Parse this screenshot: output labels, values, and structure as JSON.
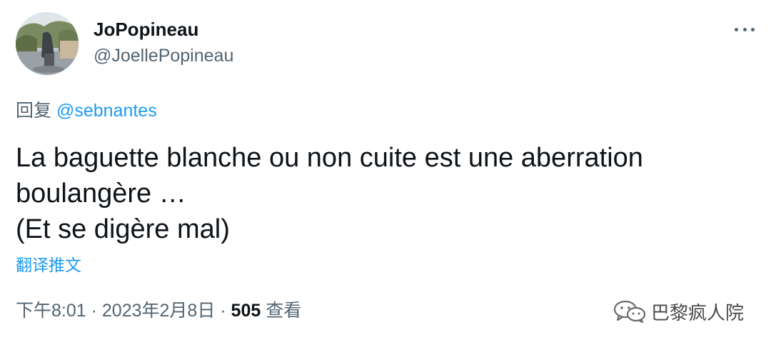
{
  "author": {
    "display_name": "JoPopineau",
    "handle": "@JoellePopineau"
  },
  "reply": {
    "prefix": "回复",
    "mention": "@sebnantes"
  },
  "tweet": {
    "lines": [
      "La baguette blanche ou non cuite est une aberration",
      "boulangère …",
      "(Et se digère mal)"
    ]
  },
  "translate_label": "翻译推文",
  "meta": {
    "time": "下午8:01",
    "separator1": " · ",
    "date": "2023年2月8日",
    "separator2": " · ",
    "views_count": "505",
    "views_label": " 查看"
  },
  "icons": {
    "more": "more-horizontal-icon",
    "watermark": "wechat-icon"
  },
  "watermark": {
    "text": "巴黎疯人院"
  },
  "colors": {
    "link": "#1d9bf0",
    "secondary_text": "#536471",
    "primary_text": "#0f1419"
  }
}
